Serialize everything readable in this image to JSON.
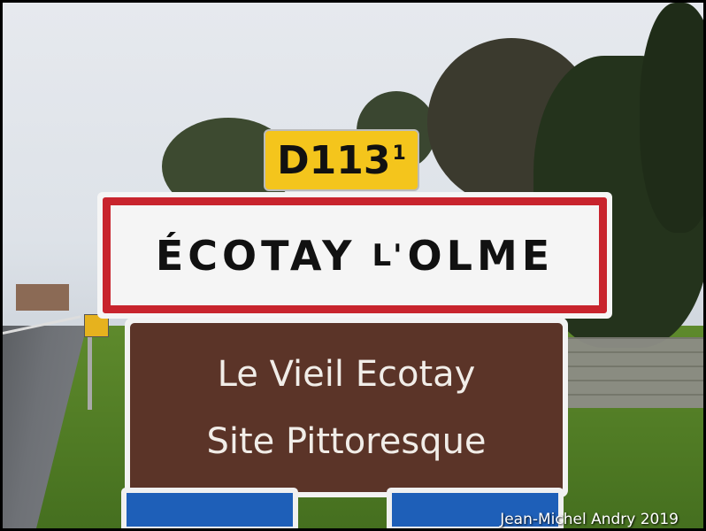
{
  "route_sign": {
    "road": "D113",
    "suffix": "1"
  },
  "town_sign": {
    "name_part1": "ÉCOTAY",
    "name_connector": "L'",
    "name_part2": "OLME"
  },
  "tourist_sign": {
    "line1": "Le Vieil Ecotay",
    "line2": "Site Pittoresque"
  },
  "credit": "Jean-Michel Andry 2019",
  "colors": {
    "route_sign_bg": "#f4c51c",
    "town_border": "#c8242d",
    "tourist_bg": "#5b3428",
    "blue_sign": "#1e5fb8"
  }
}
